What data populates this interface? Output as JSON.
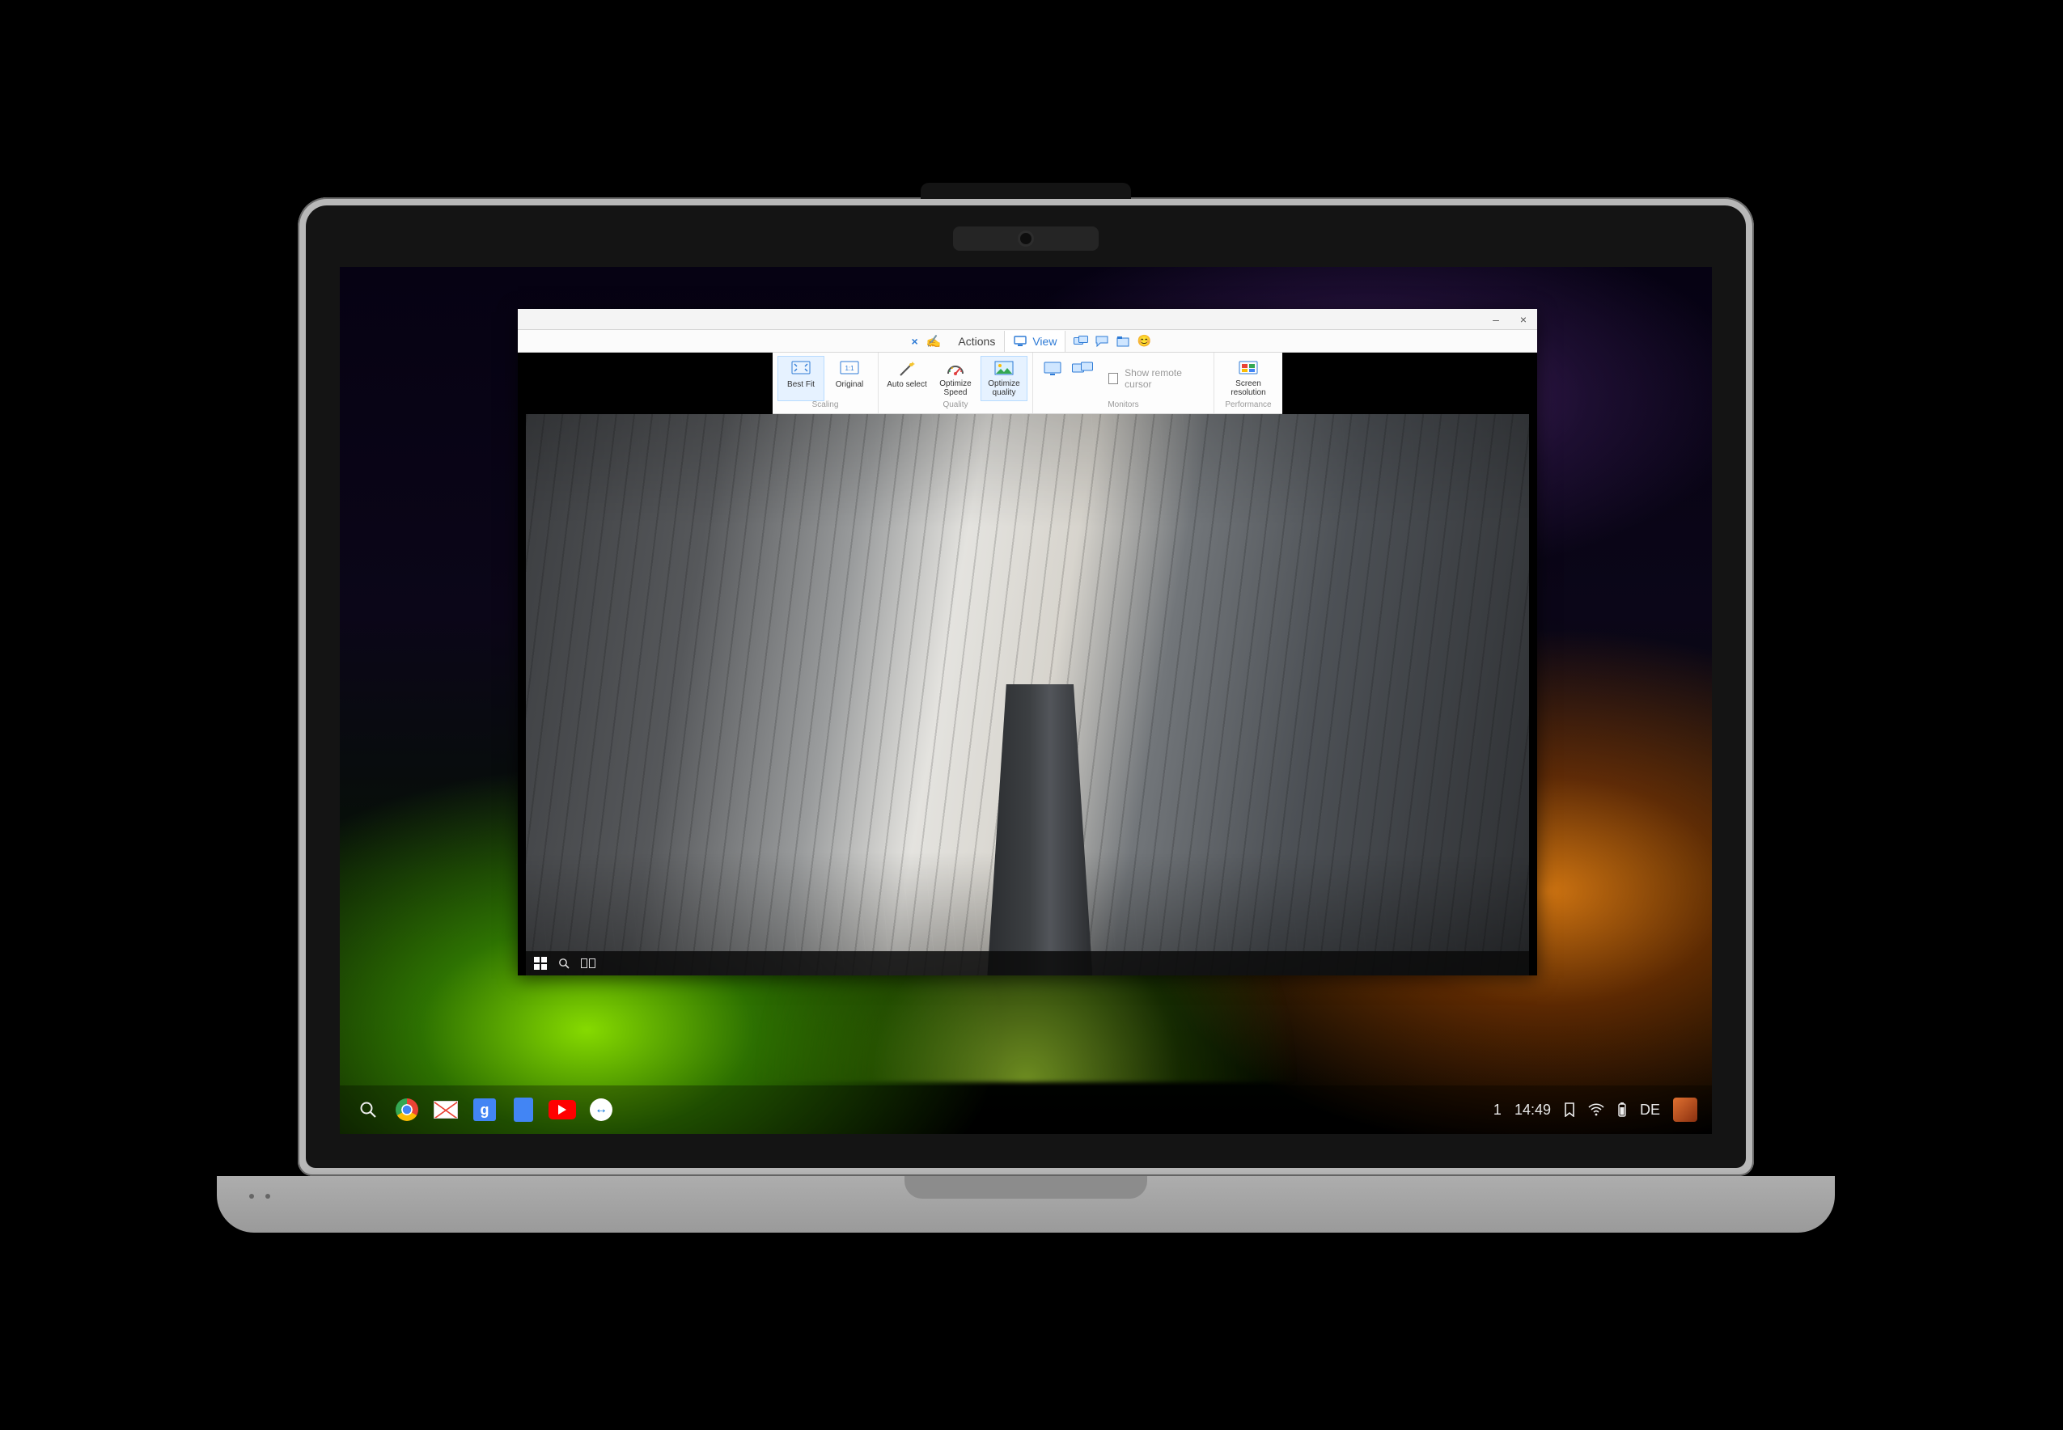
{
  "menu": {
    "close_session_label": "×",
    "pin_label": "📌",
    "tabs": {
      "actions": "Actions",
      "view": "View"
    },
    "trailing_icons": [
      "screens-icon",
      "chat-icon",
      "files-icon",
      "emoji-icon"
    ]
  },
  "ribbon": {
    "scaling": {
      "group_label": "Scaling",
      "best_fit": "Best Fit",
      "original": "Original"
    },
    "quality": {
      "group_label": "Quality",
      "auto_select": "Auto select",
      "optimize_speed": "Optimize Speed",
      "optimize_quality": "Optimize quality"
    },
    "monitors": {
      "group_label": "Monitors",
      "show_remote_cursor": "Show remote cursor"
    },
    "performance": {
      "group_label": "Performance",
      "screen_resolution": "Screen resolution"
    }
  },
  "window_controls": {
    "minimize": "–",
    "close": "×"
  },
  "shelf": {
    "apps": [
      "launcher",
      "chrome",
      "gmail",
      "google-search",
      "google-docs",
      "youtube",
      "teamviewer"
    ],
    "tray": {
      "notifications": "1",
      "time": "14:49",
      "input_lang": "DE"
    }
  },
  "remote_taskbar": {
    "items": [
      "start",
      "search",
      "task-view"
    ]
  }
}
